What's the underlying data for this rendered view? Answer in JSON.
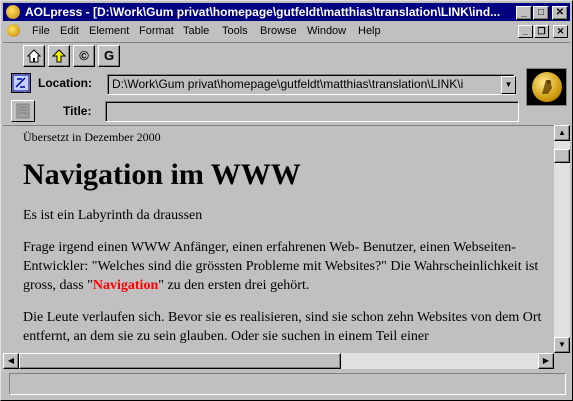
{
  "window": {
    "title": "AOLpress - [D:\\Work\\Gum privat\\homepage\\gutfeldt\\matthias\\translation\\LINK\\ind...",
    "buttons": {
      "minimize": "_",
      "maximize": "□",
      "close": "✕"
    }
  },
  "menubar": {
    "items": [
      "File",
      "Edit",
      "Element",
      "Format",
      "Table",
      "Tools",
      "Browse",
      "Window",
      "Help"
    ],
    "doc_buttons": {
      "minimize": "_",
      "restore": "❐",
      "close": "✕"
    }
  },
  "toolbar": {
    "home_icon": "home-icon",
    "up_icon": "up-arrow-icon",
    "copyright_glyph": "©",
    "g_label": "G"
  },
  "location": {
    "label": "Location:",
    "value": "D:\\Work\\Gum privat\\homepage\\gutfeldt\\matthias\\translation\\LINK\\i"
  },
  "title_field": {
    "label": "Title:",
    "value": ""
  },
  "content": {
    "note": "Übersetzt in Dezember 2000",
    "heading": "Navigation im WWW",
    "p1": "Es ist ein Labyrinth da draussen",
    "p2_before": "Frage irgend einen WWW Anfänger, einen erfahrenen Web- Benutzer, einen Webseiten- Entwickler: \"Welches sind die grössten Probleme mit Websites?\" Die Wahrscheinlichkeit ist gross, dass \"",
    "p2_highlight": "Navigation",
    "p2_after": "\" zu den ersten drei gehört.",
    "p3": "Die Leute verlaufen sich. Bevor sie es realisieren, sind sie schon zehn Websites von dem Ort entfernt, an dem sie zu sein glauben. Oder sie suchen in einem Teil einer"
  },
  "status": {
    "text": ""
  },
  "colors": {
    "titlebar": "#000080",
    "face": "#c0c0c0",
    "highlight_text": "#ff0000"
  }
}
